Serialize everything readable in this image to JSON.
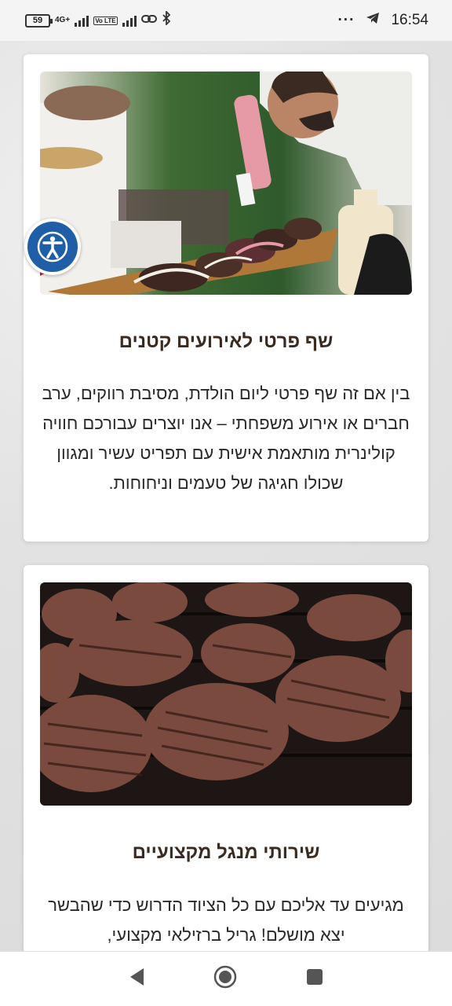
{
  "status_bar": {
    "battery": "59",
    "network_label": "4G+",
    "volte_label": "Vo LTE",
    "time": "16:54",
    "more": "···",
    "icons": [
      "battery-icon",
      "signal-icon",
      "link-icon",
      "bluetooth-icon",
      "telegram-icon"
    ]
  },
  "cards": [
    {
      "title": "שף פרטי לאירועים קטנים",
      "text": "בין אם זה שף פרטי ליום הולדת, מסיבת רווקים, ערב חברים או אירוע משפחתי – אנו יוצרים עבורכם חוויה קולינרית מותאמת אישית עם תפריט עשיר ומגוון שכולו חגיגה של טעמים וניחוחות.",
      "image": "chef-plating-dessert-photo"
    },
    {
      "title": "שירותי מנגל מקצועיים",
      "text": "מגיעים עד אליכם עם כל הציוד הדרוש כדי שהבשר יצא מושלם! גריל ברזילאי מקצועי,",
      "image": "steaks-on-grill-photo"
    }
  ],
  "accessibility_button": "accessibility-icon",
  "nav_bar": {
    "icons": [
      "back-icon",
      "home-icon",
      "recents-icon"
    ]
  },
  "colors": {
    "title": "#3b2a20",
    "accessibility_blue": "#1f5fa8",
    "card_bg": "#ffffff",
    "page_bg": "#e2e2e2"
  }
}
